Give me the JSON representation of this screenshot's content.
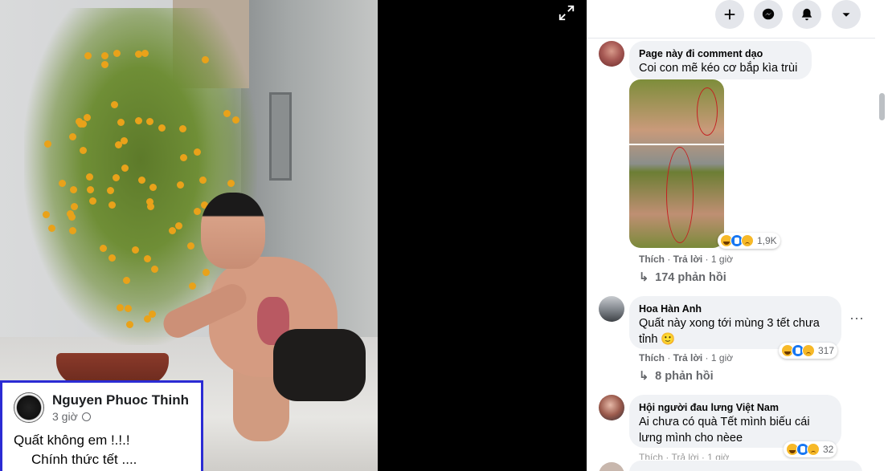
{
  "photo": {
    "expand_icon": "expand-icon",
    "post": {
      "author": "Nguyen Phuoc Thinh",
      "time": "3 giờ",
      "privacy_icon": "globe-icon",
      "line1": "Quất không em !.!.!",
      "line2": "Chính thức tết ...."
    }
  },
  "topbar": {
    "icons": [
      "plus-icon",
      "messenger-icon",
      "bell-icon",
      "caret-down-icon"
    ]
  },
  "comments": [
    {
      "author": "Page này đi comment dạo",
      "text": "Coi con mẽ kéo cơ bắp kìa trùi",
      "reactions": "1,9K",
      "like": "Thích",
      "reply": "Trả lời",
      "time": "1 giờ",
      "replies": "174 phản hồi"
    },
    {
      "author": "Hoa Hàn Anh",
      "text_line1": "Quất này xong tới mùng 3 tết chưa",
      "text_line2": "tỉnh 🙂",
      "reactions": "317",
      "like": "Thích",
      "reply": "Trả lời",
      "time": "1 giờ",
      "replies": "8 phản hồi"
    },
    {
      "author": "Hội người đau lưng Việt Nam",
      "text_line1": "Ai chưa có quà Tết mình biếu cái",
      "text_line2": "lưng mình cho nèee",
      "reactions": "32",
      "partial_actions": "Thích · Trả lời · 1 giờ"
    }
  ],
  "colors": {
    "bubble": "#f0f2f5",
    "accent": "#1877f2",
    "post_border": "#2b2bd4"
  }
}
